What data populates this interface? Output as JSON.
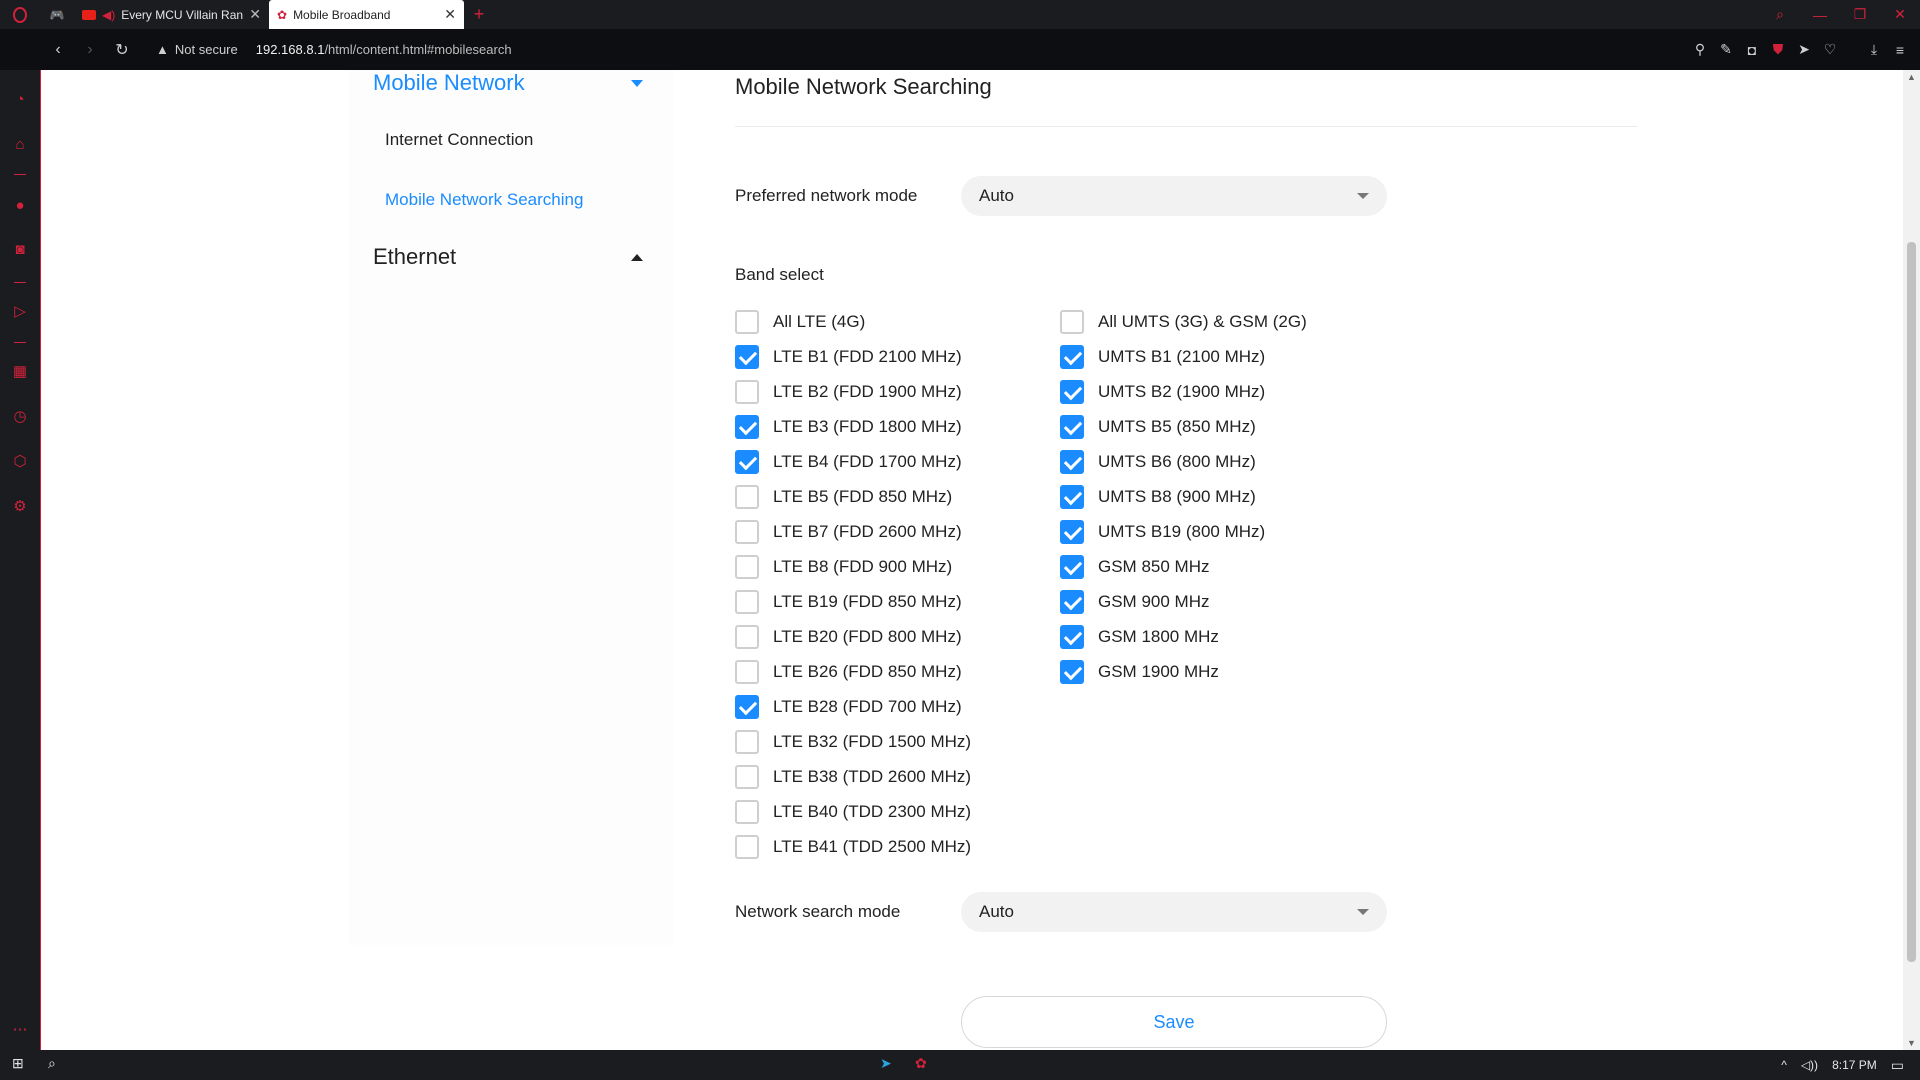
{
  "browser": {
    "tabs": [
      {
        "title": "Every MCU Villain Rank",
        "close": "✕"
      },
      {
        "title": "Mobile Broadband",
        "close": "✕"
      }
    ],
    "new_tab": "+",
    "security_label": "Not secure",
    "url_host": "192.168.8.1",
    "url_path": "/html/content.html#mobilesearch"
  },
  "leftnav": {
    "group_mobile": "Mobile Network",
    "item_internet": "Internet Connection",
    "item_search": "Mobile Network Searching",
    "group_ethernet": "Ethernet"
  },
  "main": {
    "title": "Mobile Network Searching",
    "preferred_label": "Preferred network mode",
    "preferred_value": "Auto",
    "band_label": "Band select",
    "lte_bands": [
      {
        "label": "All LTE (4G)",
        "checked": false
      },
      {
        "label": "LTE B1 (FDD 2100 MHz)",
        "checked": true
      },
      {
        "label": "LTE B2 (FDD 1900 MHz)",
        "checked": false
      },
      {
        "label": "LTE B3 (FDD 1800 MHz)",
        "checked": true
      },
      {
        "label": "LTE B4 (FDD 1700 MHz)",
        "checked": true
      },
      {
        "label": "LTE B5 (FDD 850 MHz)",
        "checked": false
      },
      {
        "label": "LTE B7 (FDD 2600 MHz)",
        "checked": false
      },
      {
        "label": "LTE B8 (FDD 900 MHz)",
        "checked": false
      },
      {
        "label": "LTE B19 (FDD 850 MHz)",
        "checked": false
      },
      {
        "label": "LTE B20 (FDD 800 MHz)",
        "checked": false
      },
      {
        "label": "LTE B26 (FDD 850 MHz)",
        "checked": false
      },
      {
        "label": "LTE B28 (FDD 700 MHz)",
        "checked": true
      },
      {
        "label": "LTE B32 (FDD 1500 MHz)",
        "checked": false
      },
      {
        "label": "LTE B38 (TDD 2600 MHz)",
        "checked": false
      },
      {
        "label": "LTE B40 (TDD 2300 MHz)",
        "checked": false
      },
      {
        "label": "LTE B41 (TDD 2500 MHz)",
        "checked": false
      }
    ],
    "umts_bands": [
      {
        "label": "All UMTS (3G) & GSM (2G)",
        "checked": false
      },
      {
        "label": "UMTS B1 (2100 MHz)",
        "checked": true
      },
      {
        "label": "UMTS B2 (1900 MHz)",
        "checked": true
      },
      {
        "label": "UMTS B5 (850 MHz)",
        "checked": true
      },
      {
        "label": "UMTS B6 (800 MHz)",
        "checked": true
      },
      {
        "label": "UMTS B8 (900 MHz)",
        "checked": true
      },
      {
        "label": "UMTS B19 (800 MHz)",
        "checked": true
      },
      {
        "label": "GSM 850 MHz",
        "checked": true
      },
      {
        "label": "GSM 900 MHz",
        "checked": true
      },
      {
        "label": "GSM 1800 MHz",
        "checked": true
      },
      {
        "label": "GSM 1900 MHz",
        "checked": true
      }
    ],
    "search_label": "Network search mode",
    "search_value": "Auto",
    "save_label": "Save"
  },
  "taskbar": {
    "clock": "8:17 PM"
  },
  "colors": {
    "accent": "#1a8cff",
    "opera_red": "#d2223b",
    "chrome_dark": "#1b1c20"
  }
}
